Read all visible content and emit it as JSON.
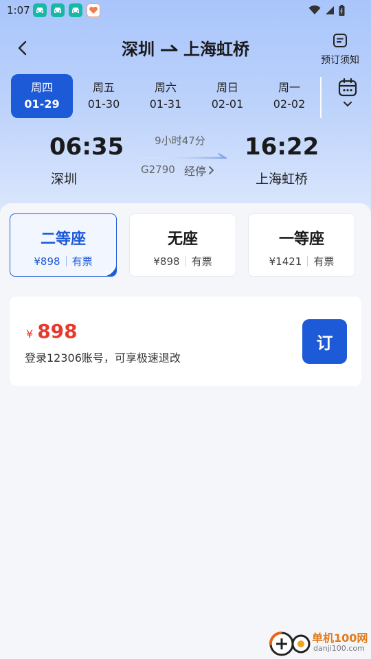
{
  "status_bar": {
    "time": "1:07",
    "apps": [
      "car-app-icon",
      "car-app-icon",
      "car-app-icon",
      "heart-app-icon"
    ]
  },
  "header": {
    "origin": "深圳",
    "destination": "上海虹桥",
    "notice_label": "预订须知"
  },
  "date_tabs": [
    {
      "weekday": "周四",
      "date": "01-29",
      "active": true
    },
    {
      "weekday": "周五",
      "date": "01-30",
      "active": false
    },
    {
      "weekday": "周六",
      "date": "01-31",
      "active": false
    },
    {
      "weekday": "周日",
      "date": "02-01",
      "active": false
    },
    {
      "weekday": "周一",
      "date": "02-02",
      "active": false
    }
  ],
  "train": {
    "departure_time": "06:35",
    "arrival_time": "16:22",
    "departure_station": "深圳",
    "arrival_station": "上海虹桥",
    "duration": "9小时47分",
    "train_no": "G2790",
    "stops_label": "经停"
  },
  "seats": [
    {
      "name": "二等座",
      "price": "¥898",
      "status": "有票",
      "selected": true
    },
    {
      "name": "无座",
      "price": "¥898",
      "status": "有票",
      "selected": false
    },
    {
      "name": "一等座",
      "price": "¥1421",
      "status": "有票",
      "selected": false
    }
  ],
  "booking": {
    "currency": "¥",
    "price": "898",
    "note": "登录12306账号，可享极速退改",
    "book_label": "订"
  },
  "watermark": {
    "name": "单机100网",
    "url": "danji100.com"
  },
  "colors": {
    "accent": "#1d5ad8",
    "price": "#e73a2f",
    "header_gradient_top": "#a9c5fb"
  }
}
